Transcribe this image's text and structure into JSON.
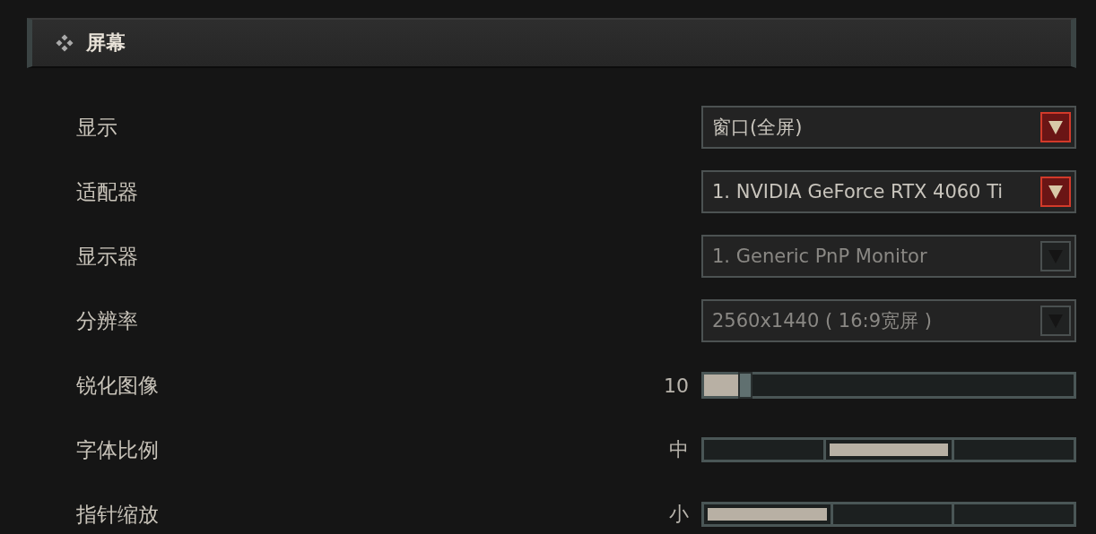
{
  "section": {
    "title": "屏幕"
  },
  "settings": [
    {
      "kind": "dropdown",
      "label": "显示",
      "value": "窗口(全屏)",
      "disabled": false
    },
    {
      "kind": "dropdown",
      "label": "适配器",
      "value": "1. NVIDIA GeForce RTX 4060 Ti",
      "disabled": false
    },
    {
      "kind": "dropdown",
      "label": "显示器",
      "value": "1. Generic PnP Monitor",
      "disabled": true
    },
    {
      "kind": "dropdown",
      "label": "分辨率",
      "value": "2560x1440 ( 16:9宽屏 )",
      "disabled": true
    },
    {
      "kind": "slider",
      "label": "锐化图像",
      "reading": "10",
      "level": 0.1
    },
    {
      "kind": "segmented",
      "label": "字体比例",
      "reading": "中",
      "segments": [
        {
          "selected": false
        },
        {
          "selected": true
        },
        {
          "selected": false
        }
      ]
    },
    {
      "kind": "segmented",
      "label": "指针缩放",
      "reading": "小",
      "segments": [
        {
          "selected": true
        },
        {
          "selected": false
        },
        {
          "selected": false
        }
      ]
    }
  ]
}
